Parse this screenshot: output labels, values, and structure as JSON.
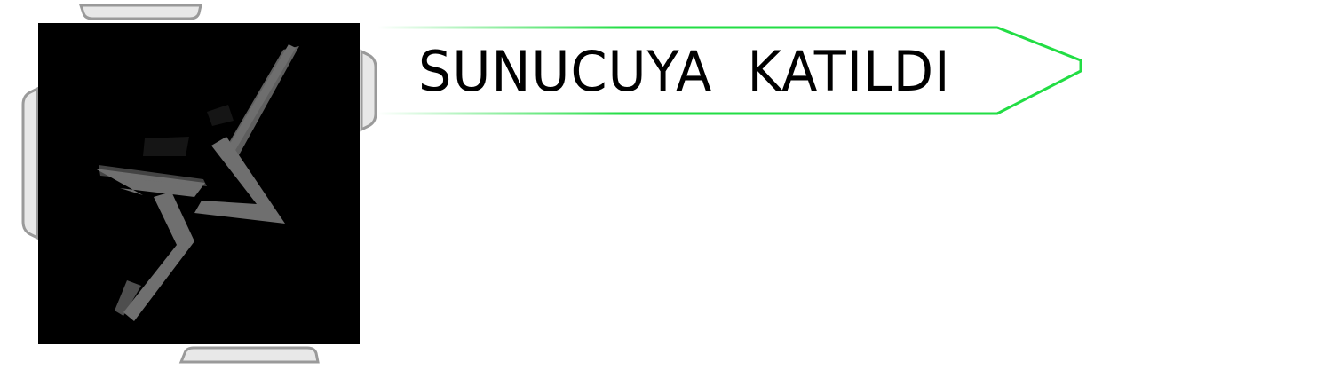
{
  "banner": {
    "text": "SUNUCUYA  KATILDI",
    "accent_color": "#22dd44"
  },
  "avatar": {
    "icon": "lightning-star-logo-icon",
    "background": "#000000",
    "mark_color": "#6f6f6f"
  },
  "frame": {
    "color": "#9a9a9a"
  }
}
